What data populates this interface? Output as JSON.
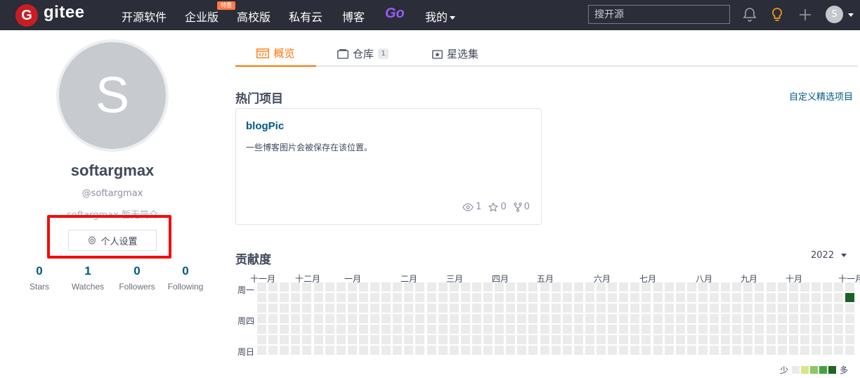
{
  "nav": {
    "brand": "gitee",
    "items": [
      "开源软件",
      "企业版",
      "高校版",
      "私有云",
      "博客"
    ],
    "badge": "特惠",
    "go": "Go",
    "mine": "我的",
    "search_placeholder": "搜开源",
    "avatar_letter": "S"
  },
  "profile": {
    "avatar_letter": "S",
    "name": "softargmax",
    "handle": "@softargmax",
    "bio": "softargmax 暂无简介",
    "settings_label": "个人设置",
    "stats": [
      {
        "num": "0",
        "label": "Stars"
      },
      {
        "num": "1",
        "label": "Watches"
      },
      {
        "num": "0",
        "label": "Followers"
      },
      {
        "num": "0",
        "label": "Following"
      }
    ]
  },
  "tabs": [
    {
      "label": "概览",
      "active": true
    },
    {
      "label": "仓库",
      "count": "1"
    },
    {
      "label": "星选集"
    }
  ],
  "hot": {
    "title": "热门项目",
    "customize": "自定义精选项目",
    "project": {
      "name": "blogPic",
      "desc": "一些博客图片会被保存在该位置。",
      "watch": "1",
      "star": "0",
      "fork": "0"
    }
  },
  "contrib": {
    "title": "贡献度",
    "year": "2022",
    "months": [
      "十一月",
      "十二月",
      "一月",
      "二月",
      "三月",
      "四月",
      "五月",
      "六月",
      "七月",
      "八月",
      "九月",
      "十月",
      "十一月"
    ],
    "weekdays": [
      "周一",
      "周四",
      "周日"
    ],
    "legend_less": "少",
    "legend_more": "多",
    "active_day": {
      "week": 52,
      "weekday": 1,
      "color": "#196127"
    },
    "legend_colors": [
      "#ebebeb",
      "#d6e685",
      "#8cc665",
      "#44a340",
      "#1e6823"
    ]
  },
  "colors": {
    "nav_bg": "#2b2d38",
    "accent": "#fe7300",
    "link": "#005980",
    "highlight_border": "#f50b0b"
  }
}
